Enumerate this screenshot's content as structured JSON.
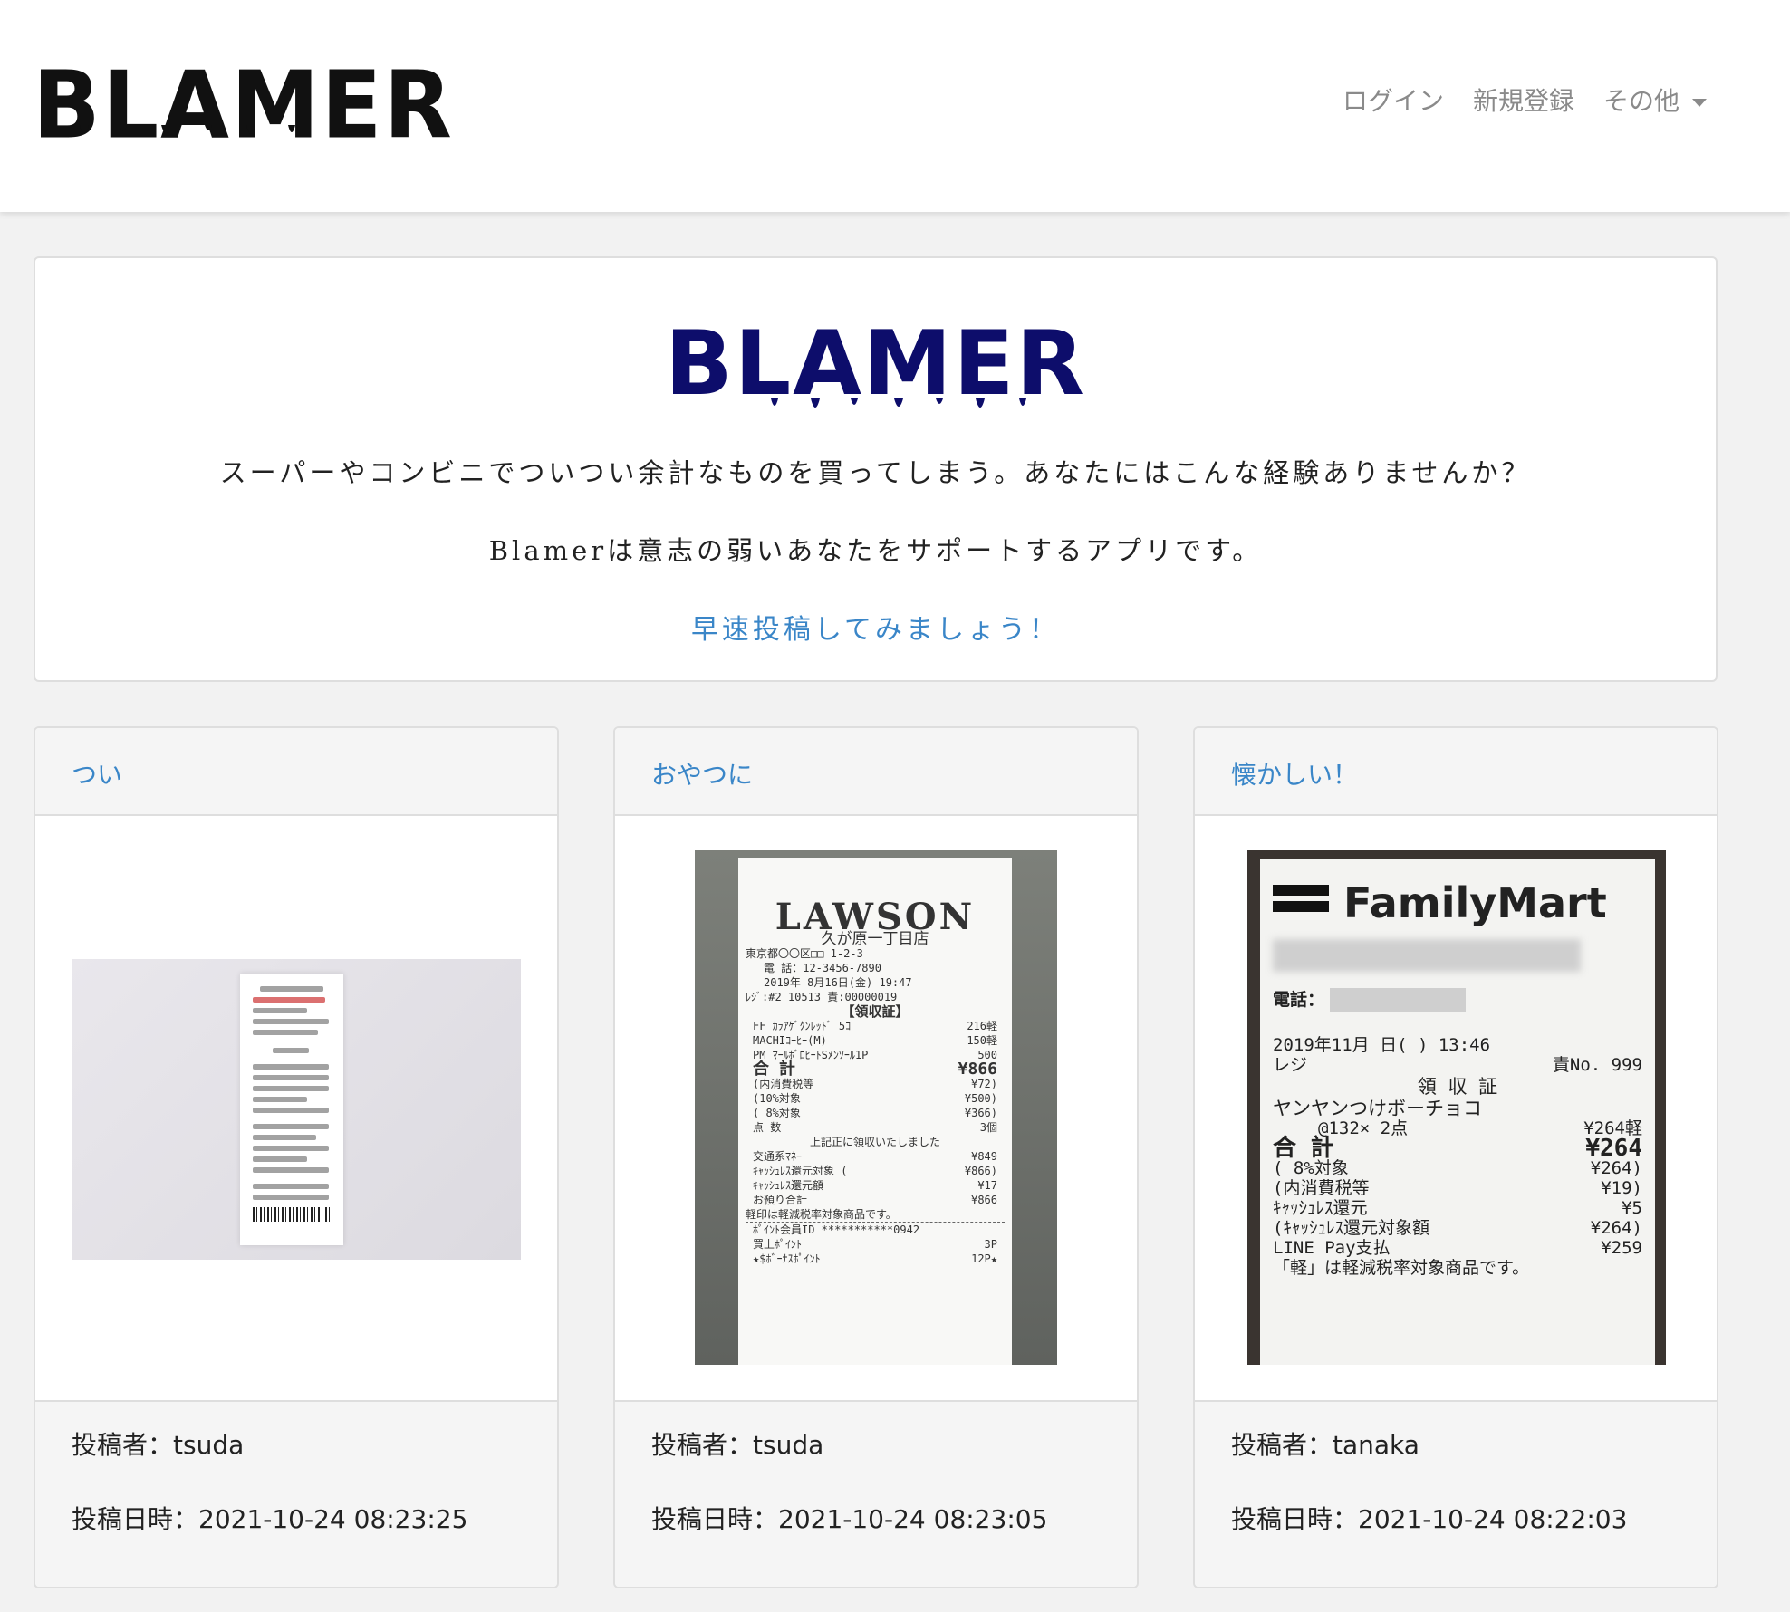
{
  "navbar": {
    "brand": "BLAMER",
    "links": [
      "ログイン",
      "新規登録",
      "その他"
    ]
  },
  "hero": {
    "logo": "BLAMER",
    "text1": "スーパーやコンビニでついつい余計なものを買ってしまう。あなたにはこんな経験ありませんか？",
    "text2": "Blamerは意志の弱いあなたをサポートするアプリです。",
    "cta": "早速投稿してみましょう！"
  },
  "posts": [
    {
      "title": "つい",
      "author": "投稿者：tsuda",
      "date": "投稿日時：2021-10-24 08:23:25",
      "image_icon": "receipt-photo"
    },
    {
      "title": "おやつに",
      "author": "投稿者：tsuda",
      "date": "投稿日時：2021-10-24 08:23:05",
      "image_icon": "lawson-receipt-photo",
      "receipt": {
        "store": "LAWSON",
        "branch": "久が原一丁目店",
        "address": "東京都〇〇区□□ 1-2-3",
        "phone": "電 話：12-3456-7890",
        "datetime": "2019年 8月16日(金) 19:47",
        "register": "ﾚｼﾞ:#2 10513   責:00000019",
        "heading": "【領収証】",
        "items": [
          [
            "FF ｶﾗｱｹﾞｸﾝﾚｯﾄﾞ 5ｺ",
            "216軽"
          ],
          [
            "MACHIｺｰﾋｰ(M)",
            "150軽"
          ],
          [
            "PM ﾏｰﾙﾎﾞﾛﾋｰﾄSﾒﾝｿｰﾙ1P",
            "500"
          ]
        ],
        "total_label": "合 計",
        "total": "¥866",
        "details": [
          [
            "(内消費税等",
            "¥72)"
          ],
          [
            "  (10%対象",
            "¥500)"
          ],
          [
            "  ( 8%対象",
            "¥366)"
          ],
          [
            "点    数",
            "3個"
          ]
        ],
        "notice": "上記正に領収いたしました",
        "payments": [
          [
            "交通系ﾏﾈｰ",
            "¥849"
          ],
          [
            "ｷｬｯｼｭﾚｽ還元対象   (",
            "¥866)"
          ],
          [
            "ｷｬｯｼｭﾚｽ還元額",
            "¥17"
          ],
          [
            "お預り合計",
            "¥866"
          ]
        ],
        "footnote": "軽印は軽減税率対象商品です。",
        "points": [
          [
            "ﾎﾟｲﾝﾄ会員ID ***********0942",
            ""
          ],
          [
            "買上ﾎﾟｲﾝﾄ",
            "3P"
          ],
          [
            "★$ﾎﾞｰﾅｽﾎﾟｲﾝﾄ",
            "12P★"
          ]
        ]
      }
    },
    {
      "title": "懐かしい！",
      "author": "投稿者：tanaka",
      "date": "投稿日時：2021-10-24 08:22:03",
      "image_icon": "familymart-receipt-photo",
      "receipt": {
        "store": "FamilyMart",
        "phone": "電話：",
        "datetime": "2019年11月  日(  ) 13:46",
        "register_left": "レジ",
        "register_right": "責No. 999",
        "heading": "領  収  証",
        "item": "ヤンヤンつけボーチョコ",
        "qty_left": "@132×  2点",
        "qty_right": "¥264軽",
        "total_label": "合 計",
        "total": "¥264",
        "details": [
          [
            "(  8%対象",
            "¥264)"
          ],
          [
            "(内消費税等",
            "¥19)"
          ],
          [
            "ｷｬｯｼｭﾚｽ還元",
            "¥5"
          ],
          [
            "(ｷｬｯｼｭﾚｽ還元対象額",
            "¥264)"
          ],
          [
            "LINE Pay支払",
            "¥259"
          ]
        ],
        "footnote": "「軽」は軽減税率対象商品です。"
      }
    }
  ]
}
